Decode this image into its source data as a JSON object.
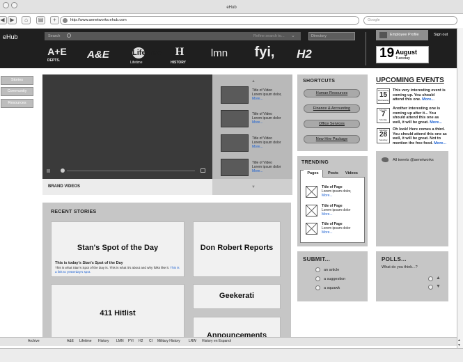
{
  "browser": {
    "window_title": "eHub",
    "url": "http://www.aenetworks.ehub.com",
    "search_placeholder": "Google",
    "back": "◀",
    "forward": "▶",
    "home": "⌂",
    "print": "▤",
    "add": "+"
  },
  "header": {
    "brand": "eHub",
    "search_placeholder": "Search",
    "refine": "Refine search to...",
    "directory": "Directory",
    "profile": "Employee Profile",
    "signout": "Sign out",
    "date_day": "19",
    "date_month": "August",
    "date_weekday": "Tuesday"
  },
  "logos": [
    "A+E",
    "A&E",
    "Lifetime",
    "H",
    "lmn",
    "fyi,",
    "H2"
  ],
  "logo_captions": {
    "depts": "DEPTS.",
    "lifetime": "Lifetime",
    "history": "HISTORY"
  },
  "left_nav": [
    "Stories",
    "Community",
    "Resources"
  ],
  "videos": {
    "section_label": "BRAND VIDEOS",
    "items": [
      {
        "title": "Title of Video",
        "desc": "Lorem ipsum dolor,",
        "more": "More..."
      },
      {
        "title": "Title of Video",
        "desc": "Lorem ipsum dolor",
        "more": "More..."
      },
      {
        "title": "Title of Video",
        "desc": "Lorem ipsum dolor",
        "more": "More..."
      },
      {
        "title": "Title of Video",
        "desc": "Lorem ipsum dolor",
        "more": "More..."
      }
    ]
  },
  "stories": {
    "heading": "RECENT STORIES",
    "stan_title": "Stan's Spot of the Day",
    "stan_sub": "This is today's Stan's Spot of the Day",
    "stan_body": "This is what Stan's Spot of the Day is. This is what it's about and why folks like it.",
    "stan_link": "This is a link to yesterday's spot.",
    "don": "Don Robert Reports",
    "hitlist": "411 Hitlist",
    "geekerati": "Geekerati",
    "announcements": "Announcements"
  },
  "shortcuts": {
    "heading": "SHORTCUTS",
    "items": [
      "Human Resources",
      "Finance & Accounting",
      "Office Services",
      "New Hire Package"
    ]
  },
  "trending": {
    "heading": "TRENDING",
    "tabs": [
      "Pages",
      "Posts",
      "Videos"
    ],
    "items": [
      {
        "title": "Title of Page",
        "desc": "Lorem ipsum dolor,",
        "more": "More..."
      },
      {
        "title": "Title of Page",
        "desc": "Lorem ipsum dolor",
        "more": "More..."
      },
      {
        "title": "Title of Page",
        "desc": "Lorem ipsum dolor",
        "more": "More..."
      }
    ]
  },
  "submit": {
    "heading": "SUBMIT...",
    "options": [
      "an article",
      "a suggestion",
      "a squawk"
    ]
  },
  "events": {
    "heading": "UPCOMING EVENTS",
    "items": [
      {
        "wd": "Wednesday",
        "day": "15",
        "wd2": "Wednesday",
        "text": "This very interesting event is coming up. You should attend this one.",
        "more": "More..."
      },
      {
        "wd": "Monday",
        "day": "7",
        "wd2": "Monday",
        "text": "Another interesting one is coming up after it... You should attend this one as well, it will be great.",
        "more": "More..."
      },
      {
        "wd": "Saturday",
        "day": "28",
        "wd2": "Saturday",
        "text": "Oh look! Here comes a third. You should attend this one as well, it will be great. Not to mention the free food.",
        "more": "More..."
      }
    ]
  },
  "tweets": {
    "label": "All tweets @aenetworks"
  },
  "polls": {
    "heading": "POLLS...",
    "question": "What do you think...?"
  },
  "footer": {
    "archive": "Archive",
    "links": [
      "A&E",
      "Lifetime",
      "History",
      "LMN",
      "FYI",
      "H2",
      "CI",
      "Military History",
      "LRW",
      "History en Espanol"
    ]
  }
}
